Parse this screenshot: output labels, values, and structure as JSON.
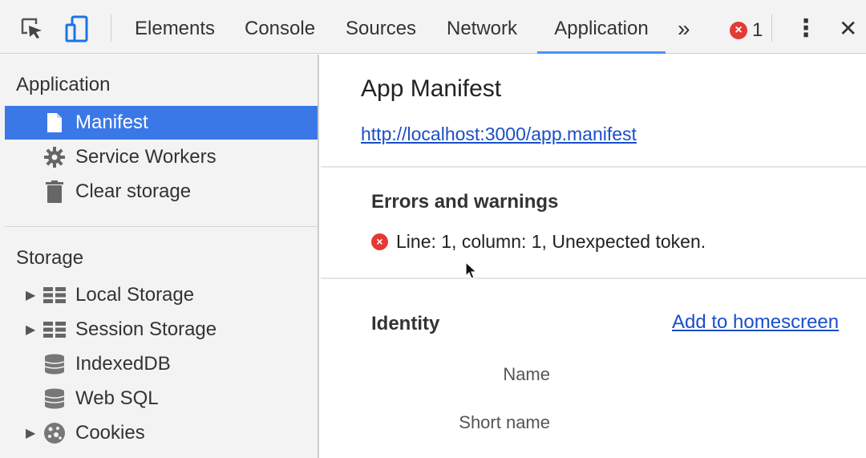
{
  "toolbar": {
    "tabs": [
      {
        "label": "Elements"
      },
      {
        "label": "Console"
      },
      {
        "label": "Sources"
      },
      {
        "label": "Network"
      },
      {
        "label": "Application"
      }
    ],
    "more_label": "»",
    "error_count": "1",
    "error_glyph": "×",
    "kebab_glyph": "⋮",
    "close_glyph": "✕",
    "accent_color": "#4d90fe"
  },
  "sidebar": {
    "application_title": "Application",
    "application_items": [
      {
        "label": "Manifest",
        "icon": "file-icon"
      },
      {
        "label": "Service Workers",
        "icon": "gear-icon"
      },
      {
        "label": "Clear storage",
        "icon": "trash-icon"
      }
    ],
    "storage_title": "Storage",
    "storage_items": [
      {
        "label": "Local Storage",
        "icon": "grid-icon"
      },
      {
        "label": "Session Storage",
        "icon": "grid-icon"
      },
      {
        "label": "IndexedDB",
        "icon": "database-icon"
      },
      {
        "label": "Web SQL",
        "icon": "database-icon"
      },
      {
        "label": "Cookies",
        "icon": "cookie-icon"
      }
    ],
    "expand_glyph": "▶",
    "selected_color": "#3b78e7"
  },
  "main": {
    "title": "App Manifest",
    "manifest_url": "http://localhost:3000/app.manifest",
    "errors_heading": "Errors and warnings",
    "error_message": "Line: 1, column: 1, Unexpected token.",
    "identity_heading": "Identity",
    "add_to_homescreen": "Add to homescreen",
    "fields": [
      {
        "label": "Name"
      },
      {
        "label": "Short name"
      }
    ]
  }
}
